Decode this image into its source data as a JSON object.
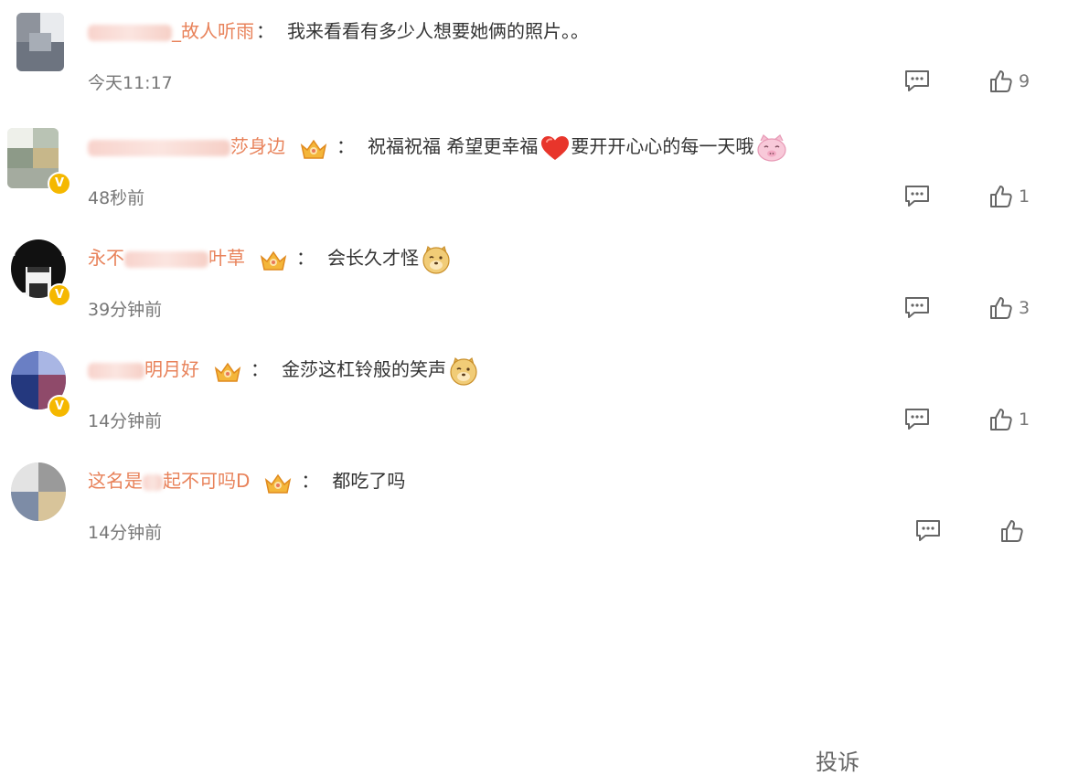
{
  "comments": [
    {
      "username": "_故人听雨",
      "text": "我来看看有多少人想要她俩的照片。。",
      "time": "今天11:17",
      "likes": "9",
      "verified": false,
      "crown": false
    },
    {
      "username": "莎身边",
      "text": "祝福祝福 希望更幸福",
      "text2": "要开开心心的每一天哦",
      "time": "48秒前",
      "likes": "1",
      "verified": true,
      "crown": true
    },
    {
      "username_prefix": "永不",
      "username": "叶草",
      "text": "会长久才怪",
      "time": "39分钟前",
      "likes": "3",
      "verified": true,
      "crown": true
    },
    {
      "username": "明月好",
      "text": "金莎这杠铃般的笑声",
      "time": "14分钟前",
      "likes": "1",
      "verified": true,
      "crown": true
    },
    {
      "username": "这名是",
      "username_suffix": "起不可吗D",
      "text": "都吃了吗",
      "time": "14分钟前",
      "likes": "",
      "verified": false,
      "crown": true
    }
  ],
  "report_label": "投诉",
  "icons": {
    "reply": "comment-icon",
    "like": "thumbs-up-icon",
    "crown": "crown-badge-icon",
    "verified": "verified-v-badge-icon"
  },
  "colors": {
    "username": "#e8825a",
    "text": "#333333",
    "meta": "#777777",
    "verified_badge": "#f5b800"
  }
}
